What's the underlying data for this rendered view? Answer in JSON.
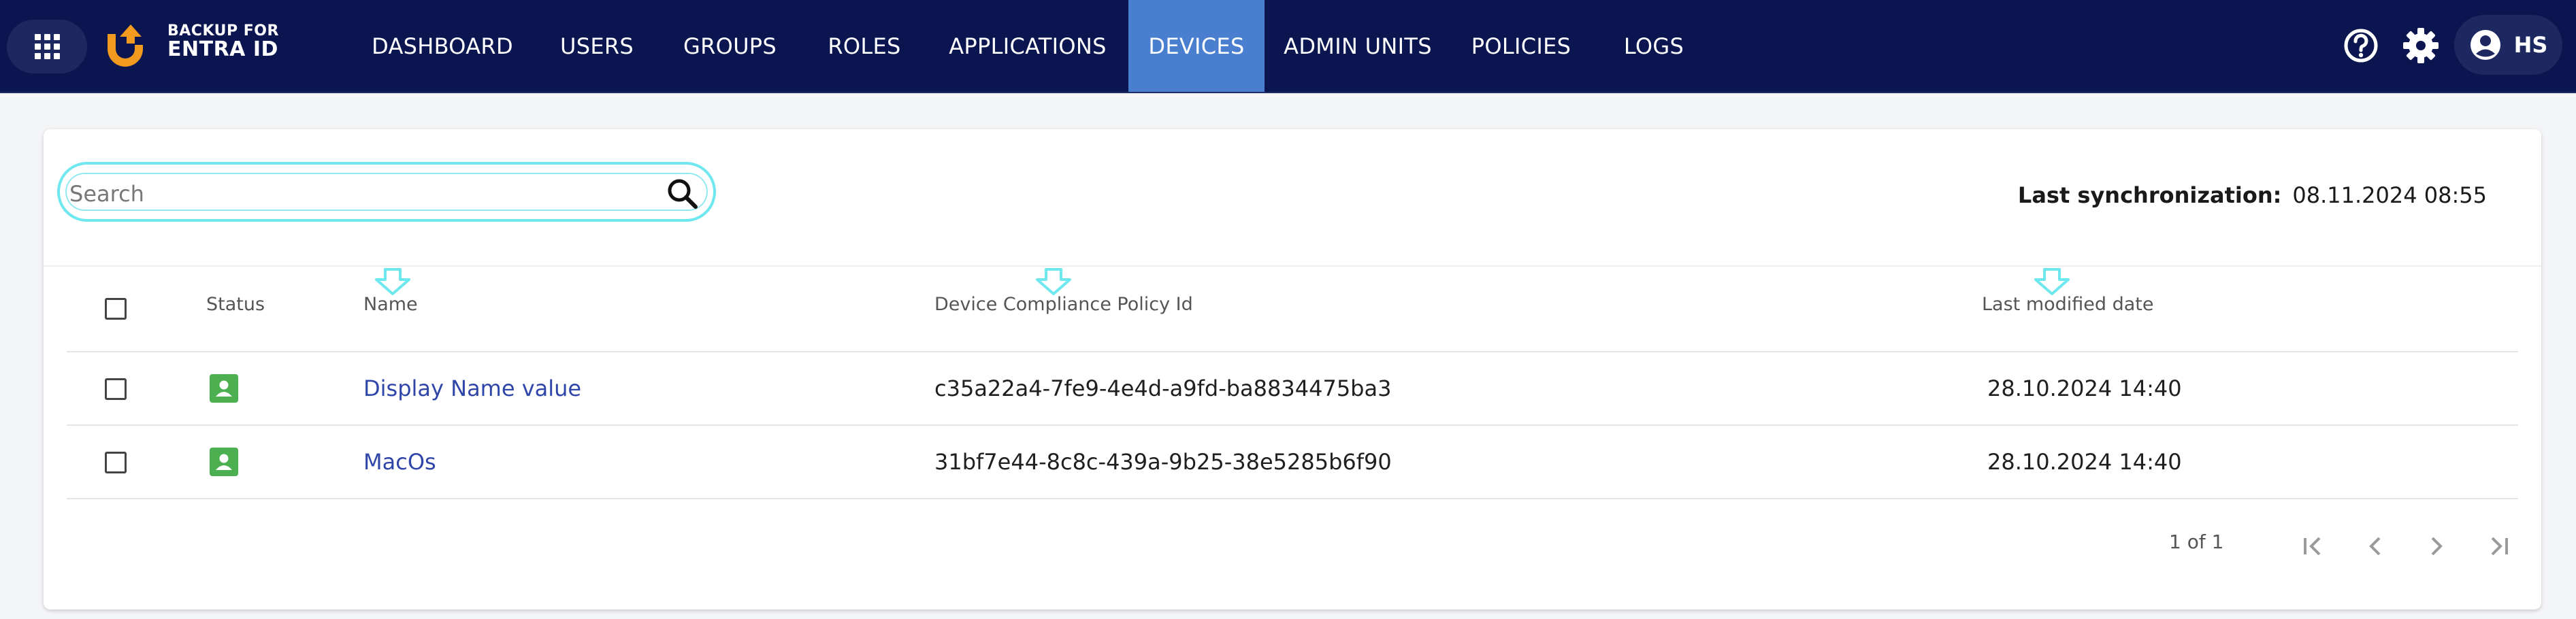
{
  "brand": {
    "line1": "BACKUP FOR",
    "line2": "ENTRA ID"
  },
  "nav": [
    {
      "label": "DASHBOARD",
      "active": false
    },
    {
      "label": "USERS",
      "active": false
    },
    {
      "label": "GROUPS",
      "active": false
    },
    {
      "label": "ROLES",
      "active": false
    },
    {
      "label": "APPLICATIONS",
      "active": false
    },
    {
      "label": "DEVICES",
      "active": true
    },
    {
      "label": "ADMIN UNITS",
      "active": false
    },
    {
      "label": "POLICIES",
      "active": false
    },
    {
      "label": "LOGS",
      "active": false
    }
  ],
  "topbar_icons": [
    "apps-grid-icon",
    "help-icon",
    "gear-icon",
    "account-circle-icon"
  ],
  "user": {
    "initials": "HS"
  },
  "search": {
    "placeholder": "Search",
    "value": ""
  },
  "sync": {
    "label": "Last synchronization:",
    "value": "08.11.2024 08:55"
  },
  "table": {
    "columns": [
      "Status",
      "Name",
      "Device Compliance Policy Id",
      "Last modified date"
    ],
    "rows": [
      {
        "name": "Display Name value",
        "policy_id": "c35a22a4-7fe9-4e4d-a9fd-ba8834475ba3",
        "modified": "28.10.2024 14:40"
      },
      {
        "name": "MacOs",
        "policy_id": "31bf7e44-8c8c-439a-9b25-38e5285b6f90",
        "modified": "28.10.2024 14:40"
      }
    ]
  },
  "pagination": {
    "text": "1 of 1"
  },
  "colors": {
    "topbar": "#0b1650",
    "nav_active": "#4a7fd0",
    "link": "#2f45a8",
    "status_ok": "#4caf50",
    "search_border": "#6fe7ef",
    "logo_orange": "#f29a1f"
  }
}
